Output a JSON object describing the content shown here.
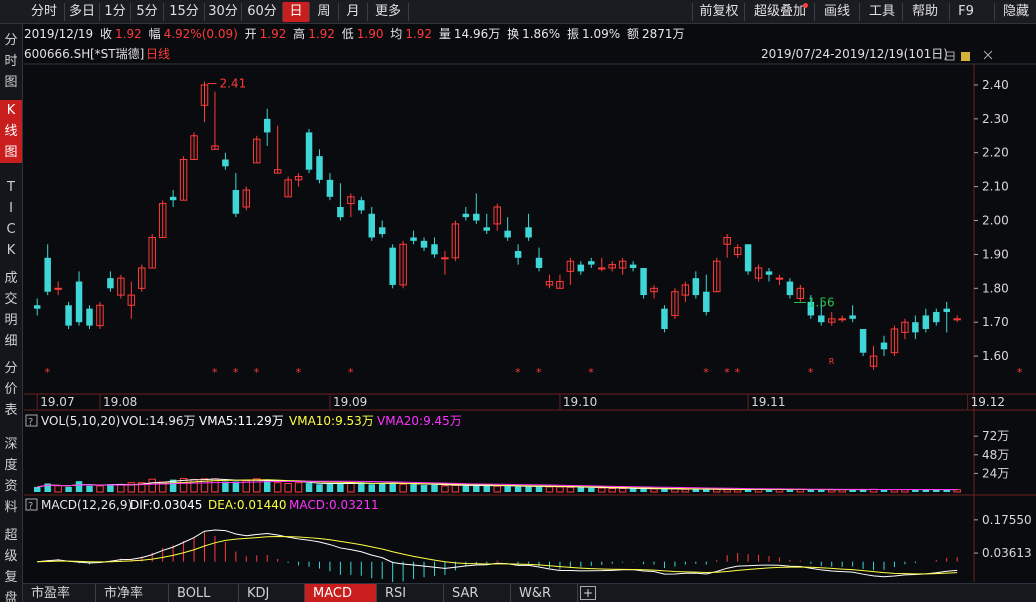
{
  "toolbar": {
    "periods": [
      "分时",
      "多日",
      "1分",
      "5分",
      "15分",
      "30分",
      "60分",
      "日",
      "周",
      "月",
      "更多"
    ],
    "active_period": "日",
    "right_buttons": [
      "前复权",
      "超级叠加",
      "画线",
      "工具",
      "帮助",
      "F9",
      "隐藏"
    ]
  },
  "sidebar": {
    "items": [
      {
        "label": "分时图",
        "active": false
      },
      {
        "label": "K线图",
        "active": true
      },
      {
        "label": "TICK",
        "active": false
      },
      {
        "label": "成交明细",
        "active": false
      },
      {
        "label": "分价表",
        "active": false
      },
      {
        "label": "深度资料",
        "active": false
      },
      {
        "label": "超级复盘",
        "active": false
      }
    ]
  },
  "quote": {
    "date": "2019/12/19",
    "close_label": "收",
    "close": "1.92",
    "change_label": "幅",
    "change": "4.92%(0.09)",
    "open_label": "开",
    "open": "1.92",
    "high_label": "高",
    "high": "1.92",
    "low_label": "低",
    "low": "1.90",
    "avg_label": "均",
    "avg": "1.92",
    "volume_label": "量",
    "volume": "14.96万",
    "turnover_label": "换",
    "turnover": "1.86%",
    "amplitude_label": "振",
    "amplitude": "1.09%",
    "amount_label": "额",
    "amount": "2871万"
  },
  "chart_header": {
    "code": "600666.SH",
    "name": "[*ST瑞德]",
    "period_label": "日线",
    "range": "2019/07/24-2019/12/19(101日)"
  },
  "volume_header": {
    "indicator": "VOL(5,10,20)",
    "vol": "VOL:14.96万",
    "ma5": "VMA5:11.29万",
    "ma10": "VMA10:9.53万",
    "ma20": "VMA20:9.45万"
  },
  "macd_header": {
    "indicator": "MACD(12,26,9)",
    "dif": "DIF:0.03045",
    "dea": "DEA:0.01440",
    "macd": "MACD:0.03211"
  },
  "bottom_tabs": [
    "市盈率",
    "市净率",
    "BOLL",
    "KDJ",
    "MACD",
    "RSI",
    "SAR",
    "W&R"
  ],
  "active_bottom_tab": "MACD",
  "colors": {
    "up": "#ff3b3b",
    "down": "#3ed6d6",
    "background": "#0a0b0e",
    "ma5": "#ffffff",
    "ma10": "#ffff44",
    "ma20": "#ff33ff",
    "active": "#c81e1e"
  },
  "chart_data": [
    {
      "type": "candlestick",
      "title": "600666.SH [*ST瑞德] 日线",
      "ylim": [
        1.5,
        2.45
      ],
      "y_ticks": [
        "2.40",
        "2.30",
        "2.20",
        "2.10",
        "2.00",
        "1.90",
        "1.80",
        "1.70",
        "1.60"
      ],
      "x_ticks": [
        "19.07",
        "19.08",
        "19.09",
        "19.10",
        "19.11",
        "19.12"
      ],
      "x_tick_index": [
        0,
        6,
        28,
        50,
        68,
        89
      ],
      "max_label": "2.41",
      "min_label": "1.56",
      "max_index": 16,
      "min_index": 72,
      "star_indices": [
        1,
        17,
        19,
        21,
        25,
        30,
        46,
        48,
        53,
        64,
        66,
        67,
        74,
        94,
        97,
        101
      ],
      "r_label": "R",
      "r_index": 76,
      "ohlc": [
        [
          1.75,
          1.77,
          1.72,
          1.74
        ],
        [
          1.89,
          1.93,
          1.78,
          1.79
        ],
        [
          1.8,
          1.82,
          1.78,
          1.8
        ],
        [
          1.75,
          1.76,
          1.68,
          1.69
        ],
        [
          1.82,
          1.85,
          1.69,
          1.7
        ],
        [
          1.74,
          1.75,
          1.68,
          1.69
        ],
        [
          1.69,
          1.76,
          1.68,
          1.75
        ],
        [
          1.83,
          1.85,
          1.79,
          1.8
        ],
        [
          1.78,
          1.84,
          1.77,
          1.83
        ],
        [
          1.75,
          1.82,
          1.71,
          1.78
        ],
        [
          1.8,
          1.87,
          1.79,
          1.86
        ],
        [
          1.86,
          1.96,
          1.86,
          1.95
        ],
        [
          1.95,
          2.06,
          1.95,
          2.05
        ],
        [
          2.07,
          2.09,
          2.04,
          2.06
        ],
        [
          2.06,
          2.19,
          2.06,
          2.18
        ],
        [
          2.18,
          2.26,
          2.18,
          2.25
        ],
        [
          2.34,
          2.41,
          2.29,
          2.4
        ],
        [
          2.21,
          2.38,
          2.21,
          2.22
        ],
        [
          2.18,
          2.2,
          2.15,
          2.16
        ],
        [
          2.09,
          2.14,
          2.01,
          2.02
        ],
        [
          2.04,
          2.1,
          2.03,
          2.09
        ],
        [
          2.17,
          2.25,
          2.17,
          2.24
        ],
        [
          2.3,
          2.33,
          2.22,
          2.26
        ],
        [
          2.14,
          2.28,
          2.14,
          2.15
        ],
        [
          2.07,
          2.13,
          2.07,
          2.12
        ],
        [
          2.12,
          2.14,
          2.1,
          2.13
        ],
        [
          2.26,
          2.27,
          2.14,
          2.15
        ],
        [
          2.19,
          2.21,
          2.11,
          2.12
        ],
        [
          2.12,
          2.14,
          2.06,
          2.07
        ],
        [
          2.04,
          2.11,
          2.0,
          2.01
        ],
        [
          2.05,
          2.08,
          2.01,
          2.07
        ],
        [
          2.06,
          2.07,
          2.02,
          2.03
        ],
        [
          2.02,
          2.04,
          1.94,
          1.95
        ],
        [
          1.98,
          2.0,
          1.95,
          1.96
        ],
        [
          1.92,
          1.93,
          1.8,
          1.81
        ],
        [
          1.81,
          1.94,
          1.8,
          1.93
        ],
        [
          1.95,
          1.97,
          1.93,
          1.94
        ],
        [
          1.94,
          1.95,
          1.91,
          1.92
        ],
        [
          1.93,
          1.95,
          1.89,
          1.9
        ],
        [
          1.89,
          1.91,
          1.84,
          1.89
        ],
        [
          1.89,
          2.0,
          1.88,
          1.99
        ],
        [
          2.02,
          2.04,
          2.0,
          2.01
        ],
        [
          2.02,
          2.08,
          1.99,
          2.0
        ],
        [
          1.98,
          2.02,
          1.96,
          1.97
        ],
        [
          1.99,
          2.05,
          1.97,
          2.04
        ],
        [
          1.97,
          2.01,
          1.94,
          1.95
        ],
        [
          1.91,
          1.93,
          1.87,
          1.89
        ],
        [
          1.98,
          2.02,
          1.94,
          1.95
        ],
        [
          1.89,
          1.92,
          1.85,
          1.86
        ],
        [
          1.81,
          1.84,
          1.8,
          1.82
        ],
        [
          1.8,
          1.84,
          1.8,
          1.82
        ],
        [
          1.85,
          1.89,
          1.81,
          1.88
        ],
        [
          1.87,
          1.88,
          1.84,
          1.85
        ],
        [
          1.88,
          1.89,
          1.86,
          1.87
        ],
        [
          1.86,
          1.89,
          1.85,
          1.86
        ],
        [
          1.86,
          1.88,
          1.85,
          1.87
        ],
        [
          1.86,
          1.89,
          1.84,
          1.88
        ],
        [
          1.87,
          1.88,
          1.85,
          1.86
        ],
        [
          1.86,
          1.86,
          1.77,
          1.78
        ],
        [
          1.79,
          1.81,
          1.77,
          1.8
        ],
        [
          1.74,
          1.75,
          1.67,
          1.68
        ],
        [
          1.72,
          1.8,
          1.71,
          1.79
        ],
        [
          1.78,
          1.82,
          1.76,
          1.81
        ],
        [
          1.83,
          1.85,
          1.77,
          1.78
        ],
        [
          1.79,
          1.84,
          1.72,
          1.73
        ],
        [
          1.79,
          1.89,
          1.79,
          1.88
        ],
        [
          1.93,
          1.96,
          1.89,
          1.95
        ],
        [
          1.9,
          1.93,
          1.89,
          1.92
        ],
        [
          1.93,
          1.93,
          1.84,
          1.85
        ],
        [
          1.83,
          1.87,
          1.82,
          1.86
        ],
        [
          1.85,
          1.86,
          1.82,
          1.84
        ],
        [
          1.83,
          1.84,
          1.81,
          1.83
        ],
        [
          1.82,
          1.83,
          1.77,
          1.78
        ],
        [
          1.77,
          1.81,
          1.76,
          1.8
        ],
        [
          1.76,
          1.78,
          1.71,
          1.72
        ],
        [
          1.72,
          1.76,
          1.69,
          1.7
        ],
        [
          1.7,
          1.73,
          1.69,
          1.71
        ],
        [
          1.71,
          1.72,
          1.7,
          1.71
        ],
        [
          1.72,
          1.75,
          1.7,
          1.71
        ],
        [
          1.68,
          1.68,
          1.6,
          1.61
        ],
        [
          1.57,
          1.63,
          1.56,
          1.6
        ],
        [
          1.64,
          1.66,
          1.6,
          1.62
        ],
        [
          1.61,
          1.69,
          1.6,
          1.68
        ],
        [
          1.67,
          1.71,
          1.65,
          1.7
        ],
        [
          1.7,
          1.72,
          1.65,
          1.67
        ],
        [
          1.72,
          1.74,
          1.67,
          1.68
        ],
        [
          1.73,
          1.74,
          1.69,
          1.7
        ],
        [
          1.74,
          1.76,
          1.67,
          1.73
        ],
        [
          1.71,
          1.72,
          1.7,
          1.71
        ]
      ],
      "volume": [
        6.5,
        11,
        8,
        6.5,
        14,
        8,
        8,
        10,
        9,
        12,
        12,
        16.5,
        13,
        16,
        17.5,
        16,
        17,
        17,
        13.5,
        13.5,
        14.5,
        17,
        16,
        12,
        11,
        12,
        11.5,
        10,
        10.5,
        11,
        12,
        12.5,
        10,
        11,
        12,
        10,
        10,
        9,
        9.5,
        8,
        8.5,
        8,
        9,
        8,
        7.5,
        7.5,
        7,
        7,
        7.5,
        6.5,
        6.5,
        6,
        6,
        5.5,
        5,
        4.5,
        4.5,
        4.5,
        4,
        4,
        4,
        4,
        3.5,
        3.5,
        3.5,
        3.5,
        3,
        3,
        3,
        3.5,
        3.5,
        3.5,
        3,
        3.5,
        3,
        3,
        3,
        3,
        3,
        3.5,
        3.5,
        3.5,
        3,
        3,
        3,
        3,
        3,
        3,
        3,
        3,
        3,
        3,
        3,
        3,
        3,
        3,
        3,
        3,
        3.5,
        6.5,
        14.96
      ],
      "volume_ticks": [
        "72万",
        "48万",
        "24万"
      ],
      "macd_ticks": [
        "0.17550",
        "0.03613"
      ]
    }
  ]
}
